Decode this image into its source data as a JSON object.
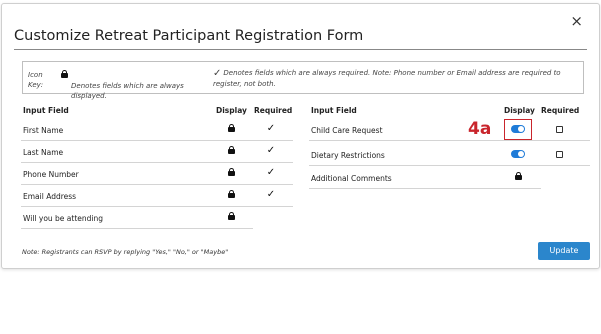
{
  "modal": {
    "title": "Customize Retreat Participant Registration Form",
    "close_glyph": "×"
  },
  "key": {
    "label": "Icon Key:",
    "lock_text": "Denotes fields which are always displayed.",
    "check_glyph": "✓",
    "check_text": "Denotes fields which are always required. Note: Phone number or Email address are required to register, not both."
  },
  "left_table": {
    "headers": {
      "field": "Input Field",
      "display": "Display",
      "required": "Required"
    },
    "rows": [
      {
        "label": "First Name",
        "display": "lock-icon",
        "required": "✓"
      },
      {
        "label": "Last Name",
        "display": "lock-icon",
        "required": "✓"
      },
      {
        "label": "Phone Number",
        "display": "lock-icon",
        "required": "✓"
      },
      {
        "label": "Email Address",
        "display": "lock-icon",
        "required": "✓"
      },
      {
        "label": "Will you be attending",
        "display": "lock-icon",
        "required": ""
      }
    ]
  },
  "right_table": {
    "headers": {
      "field": "Input Field",
      "display": "Display",
      "required": "Required"
    },
    "rows": [
      {
        "label": "Child Care Request",
        "display": "toggle-on",
        "required": "checkbox-unchecked"
      },
      {
        "label": "Dietary Restrictions",
        "display": "toggle-on",
        "required": "checkbox-unchecked"
      },
      {
        "label": "Additional Comments",
        "display": "lock-icon",
        "required": ""
      }
    ]
  },
  "callout": {
    "label": "4a"
  },
  "footer": {
    "note": "Note: Registrants can RSVP by replying \"Yes,\" \"No,\" or \"Maybe\"",
    "update_label": "Update"
  },
  "colors": {
    "accent": "#2b86cc",
    "toggle_on": "#1f7bd8",
    "callout": "#c9252c"
  }
}
